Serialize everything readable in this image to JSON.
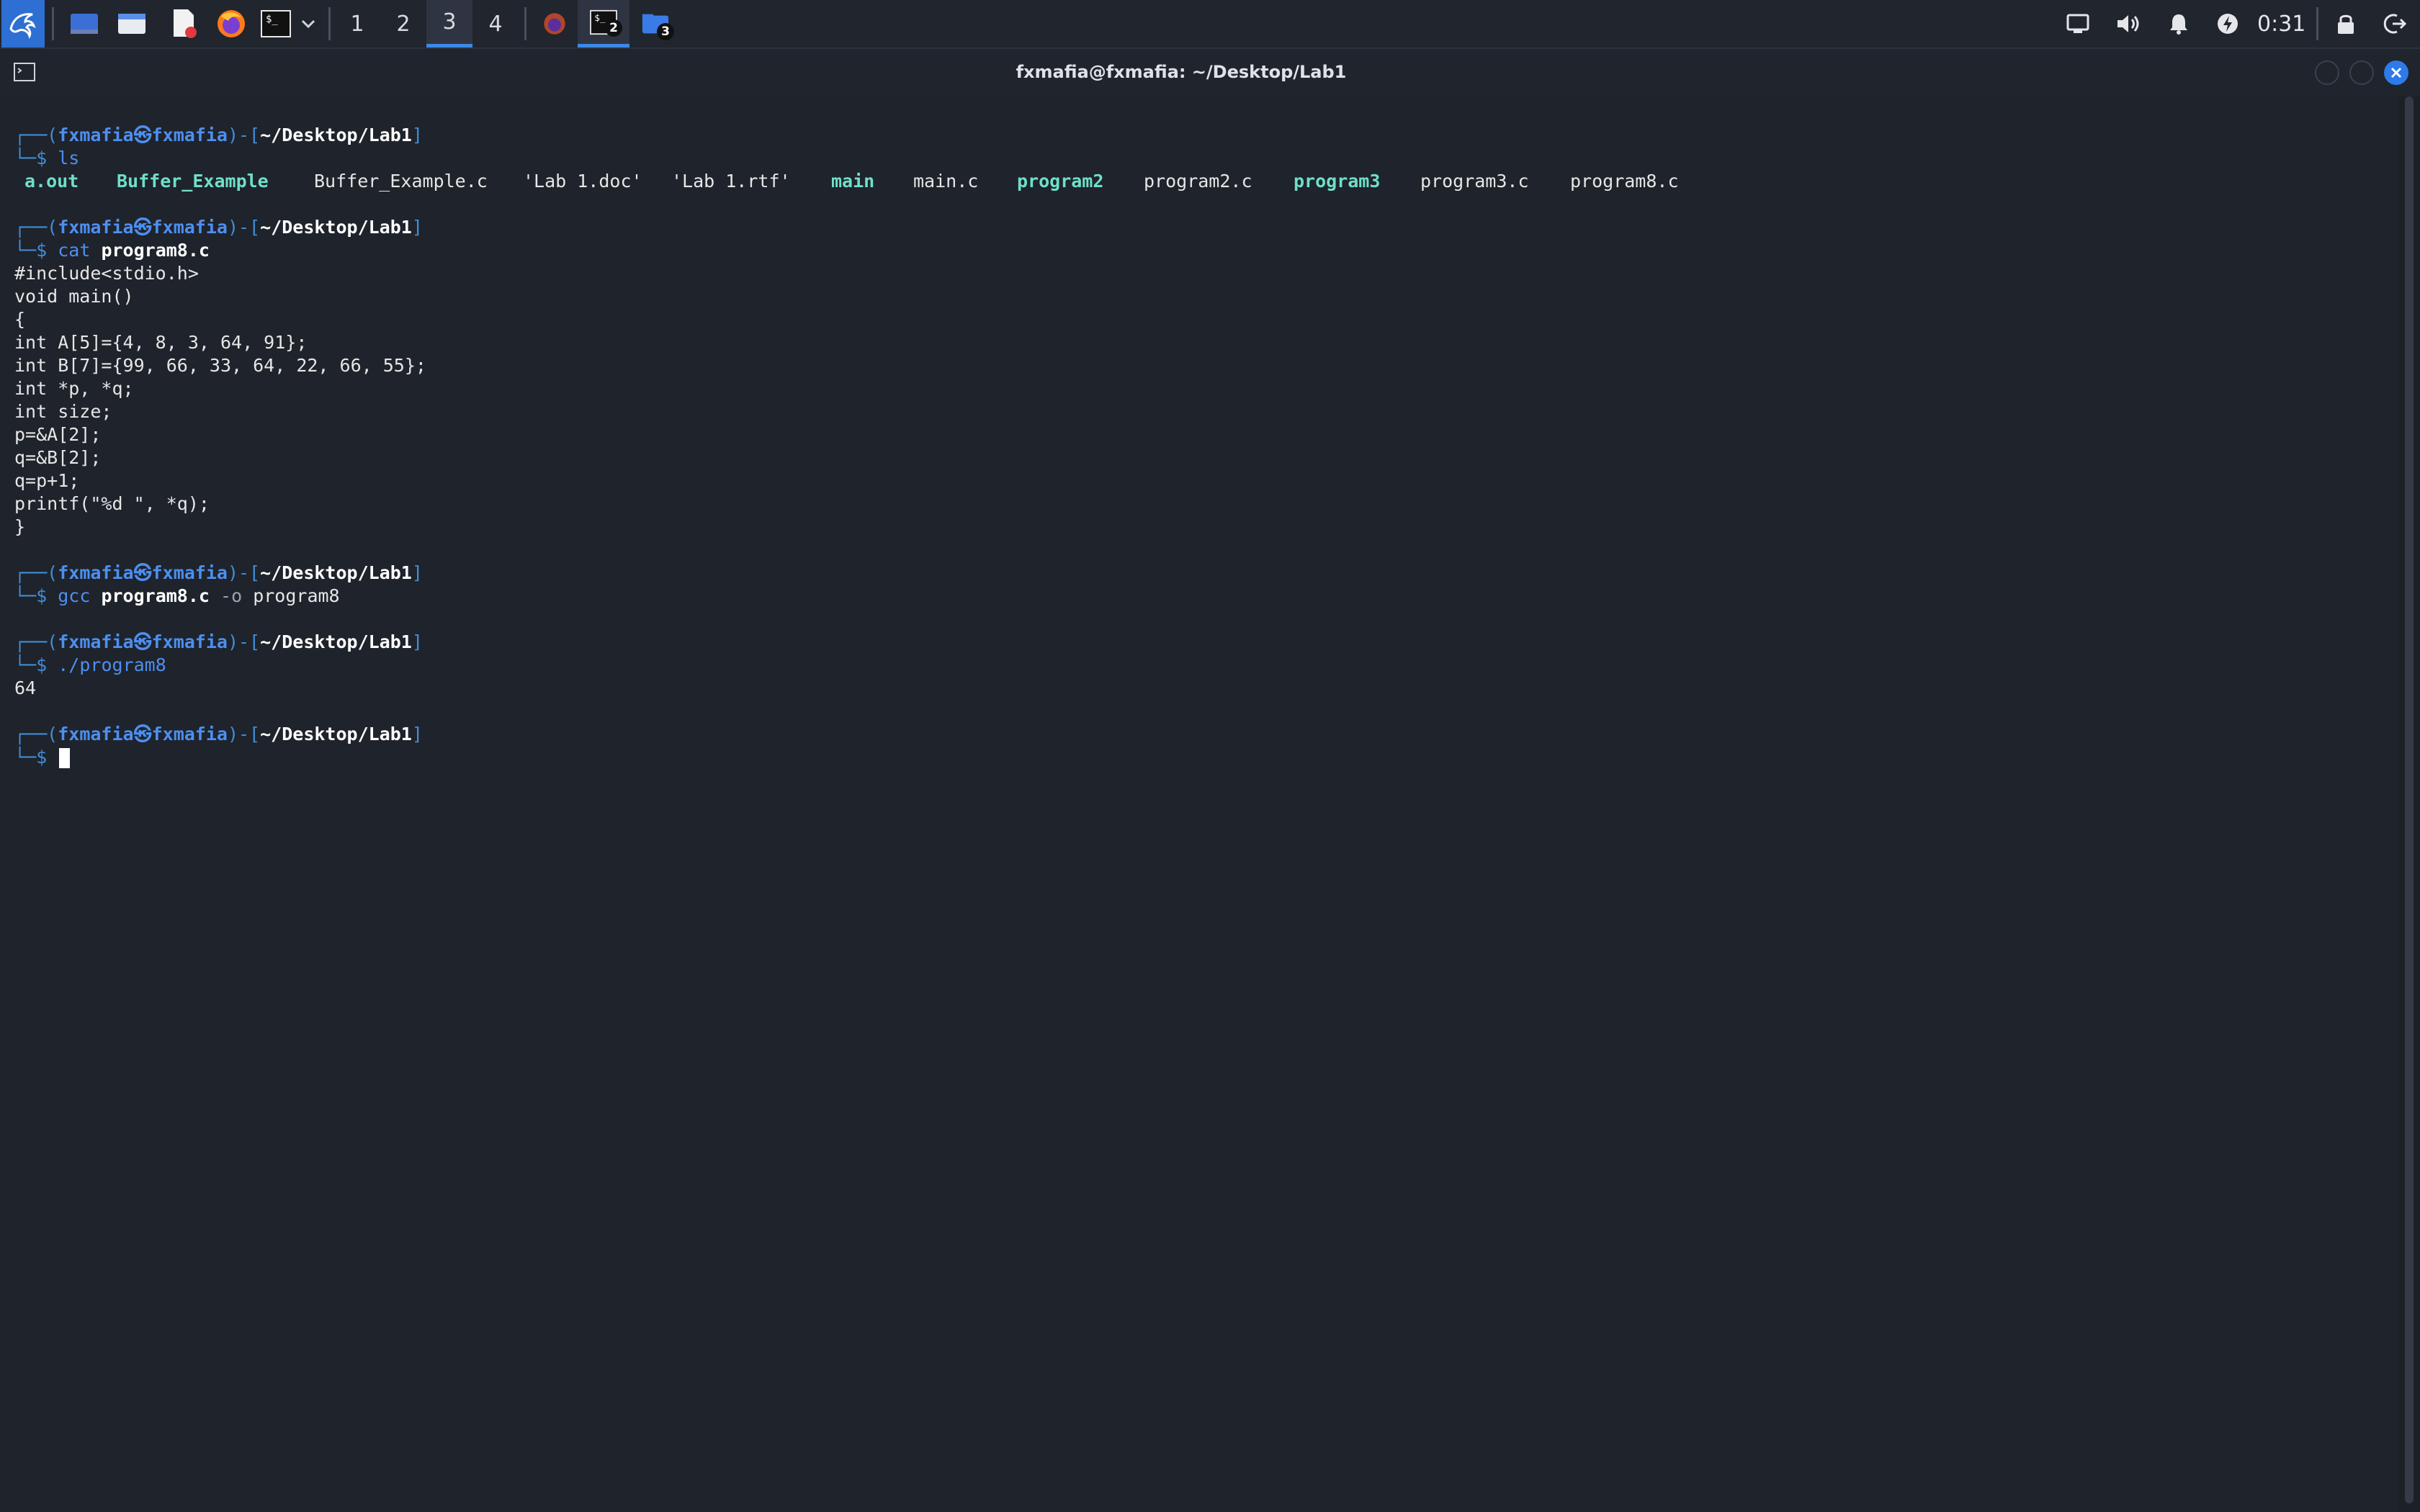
{
  "taskbar": {
    "workspaces": [
      "1",
      "2",
      "3",
      "4"
    ],
    "active_workspace": "3",
    "terminal_badge": "2",
    "files_badge": "3",
    "clock": "0:31"
  },
  "window": {
    "title": "fxmafia@fxmafia: ~/Desktop/Lab1"
  },
  "prompt": {
    "user": "fxmafia",
    "host": "fxmafia",
    "at": "㉿",
    "path": "~/Desktop/Lab1",
    "dollar": "$"
  },
  "terminal": {
    "cmd1": "ls",
    "ls_output": [
      {
        "name": "a.out",
        "type": "exe"
      },
      {
        "name": "Buffer_Example",
        "type": "exe"
      },
      {
        "name": "Buffer_Example.c",
        "type": "plain"
      },
      {
        "name": "'Lab 1.doc'",
        "type": "plain"
      },
      {
        "name": "'Lab 1.rtf'",
        "type": "plain"
      },
      {
        "name": "main",
        "type": "exe"
      },
      {
        "name": "main.c",
        "type": "plain"
      },
      {
        "name": "program2",
        "type": "exe"
      },
      {
        "name": "program2.c",
        "type": "plain"
      },
      {
        "name": "program3",
        "type": "exe"
      },
      {
        "name": "program3.c",
        "type": "plain"
      },
      {
        "name": "program8.c",
        "type": "plain"
      }
    ],
    "cmd2_name": "cat",
    "cmd2_arg": "program8.c",
    "code_lines": [
      "#include<stdio.h>",
      "void main()",
      "{",
      "int A[5]={4, 8, 3, 64, 91};",
      "int B[7]={99, 66, 33, 64, 22, 66, 55};",
      "int *p, *q;",
      "int size;",
      "p=&A[2];",
      "q=&B[2];",
      "q=p+1;",
      "printf(\"%d \", *q);",
      "}"
    ],
    "cmd3_name": "gcc",
    "cmd3_arg": "program8.c",
    "cmd3_opt": "-o",
    "cmd3_out": "program8",
    "cmd4": "./program8",
    "output": "64"
  }
}
